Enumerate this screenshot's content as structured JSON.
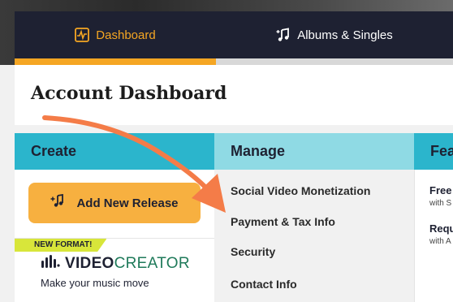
{
  "tabs": {
    "dashboard": {
      "label": "Dashboard",
      "icon": "activity-chart-icon"
    },
    "albums": {
      "label": "Albums & Singles",
      "icon": "music-notes-plus-icon"
    }
  },
  "page": {
    "title": "Account Dashboard"
  },
  "columns": {
    "create": {
      "header": "Create",
      "add_release": {
        "label": "Add New Release",
        "icon": "music-note-plus-icon"
      },
      "badge": "NEW FORMAT!",
      "video_creator": {
        "logo_word1": "VIDEO",
        "logo_word2": "CREATOR",
        "tagline": "Make your music move"
      }
    },
    "manage": {
      "header": "Manage",
      "links": [
        "Social Video Monetization",
        "Payment & Tax Info",
        "Security",
        "Contact Info"
      ]
    },
    "featured": {
      "header": "Fea",
      "items": [
        {
          "title": "Free",
          "sub": "with S"
        },
        {
          "title": "Requ",
          "sub": "with A"
        }
      ]
    }
  },
  "colors": {
    "nav_bg": "#1e2132",
    "accent_orange": "#f5a623",
    "create_teal": "#2bb5cc",
    "manage_teal_light": "#8fdae4",
    "annotation_arrow": "#f47c48",
    "badge_yellow": "#d8e63a"
  }
}
